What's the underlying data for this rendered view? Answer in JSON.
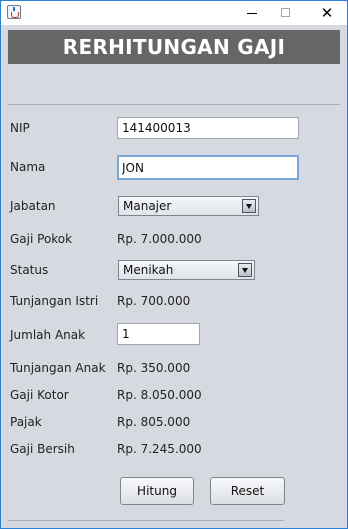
{
  "header": {
    "title": "RERHITUNGAN GAJI"
  },
  "form": {
    "nip": {
      "label": "NIP",
      "value": "141400013"
    },
    "nama": {
      "label": "Nama",
      "value": "JON"
    },
    "jabatan": {
      "label": "Jabatan",
      "selected": "Manajer"
    },
    "gaji_pokok": {
      "label": "Gaji Pokok",
      "value": "Rp. 7.000.000"
    },
    "status": {
      "label": "Status",
      "selected": "Menikah"
    },
    "tunjangan_istri": {
      "label": "Tunjangan Istri",
      "value": "Rp. 700.000"
    },
    "jumlah_anak": {
      "label": "Jumlah Anak",
      "value": "1"
    },
    "tunjangan_anak": {
      "label": "Tunjangan Anak",
      "value": "Rp. 350.000"
    },
    "gaji_kotor": {
      "label": "Gaji Kotor",
      "value": "Rp. 8.050.000"
    },
    "pajak": {
      "label": "Pajak",
      "value": "Rp. 805.000"
    },
    "gaji_bersih": {
      "label": "Gaji Bersih",
      "value": "Rp. 7.245.000"
    }
  },
  "buttons": {
    "hitung": "Hitung",
    "reset": "Reset"
  },
  "window_controls": {
    "close": "✕"
  },
  "icons": {
    "app": "java-app-icon",
    "minimize": "minimize-icon",
    "maximize": "maximize-icon",
    "close": "close-icon",
    "dropdown": "chevron-down-icon"
  },
  "colors": {
    "header_bg": "#666666",
    "window_bg": "#d6d9df",
    "border": "#2b7fd6"
  }
}
